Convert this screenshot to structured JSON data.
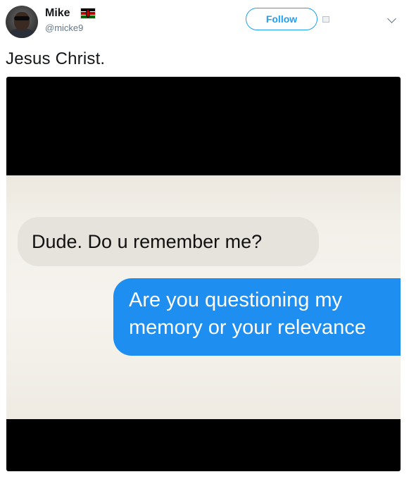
{
  "user": {
    "name": "Mike",
    "handle": "@micke9",
    "flag_icon": "kenya-flag-icon",
    "avatar_icon": "user-avatar"
  },
  "actions": {
    "follow_label": "Follow",
    "caret_icon": "chevron-down-icon"
  },
  "tweet": {
    "text": "Jesus Christ."
  },
  "media": {
    "incoming_message": "Dude. Do u remember me?",
    "outgoing_message_line1": "Are you questioning my",
    "outgoing_message_line2": "memory or your relevance"
  },
  "colors": {
    "accent": "#1da1f2",
    "outgoing_bubble": "#1f8ef1",
    "incoming_bubble": "#e6e2dc"
  }
}
